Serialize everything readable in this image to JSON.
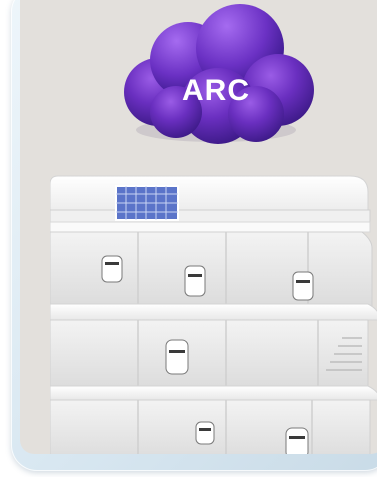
{
  "app": {
    "cloud_label": "ARC",
    "icons": [
      "cloud-icon",
      "building-illustration",
      "solar-panel-icon",
      "robot-icon"
    ],
    "colors": {
      "screen_bg": "#e3e0dc",
      "cloud_main": "#6a2fc0",
      "cloud_dark": "#3b1a8c",
      "frame": "#d8e7f1",
      "building": "#f7f7f7"
    }
  }
}
